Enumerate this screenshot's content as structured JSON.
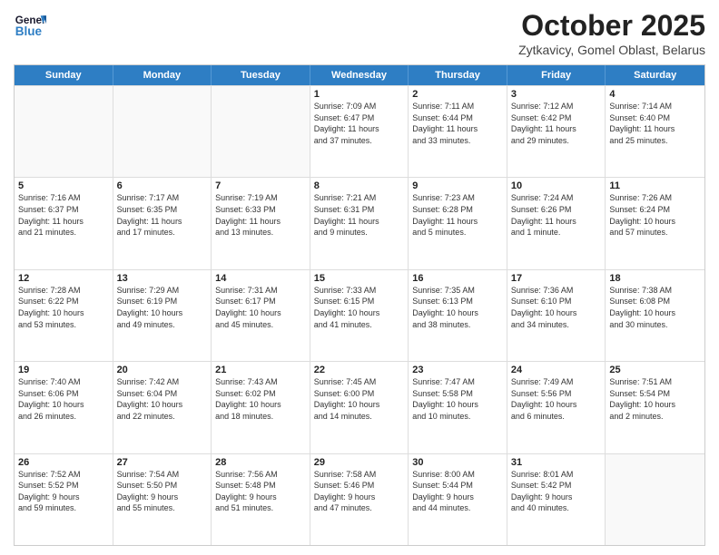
{
  "header": {
    "logo_general": "General",
    "logo_blue": "Blue",
    "title": "October 2025",
    "subtitle": "Zytkavicy, Gomel Oblast, Belarus"
  },
  "weekdays": [
    "Sunday",
    "Monday",
    "Tuesday",
    "Wednesday",
    "Thursday",
    "Friday",
    "Saturday"
  ],
  "rows": [
    {
      "cells": [
        {
          "day": "",
          "lines": [],
          "empty": true
        },
        {
          "day": "",
          "lines": [],
          "empty": true
        },
        {
          "day": "",
          "lines": [],
          "empty": true
        },
        {
          "day": "1",
          "lines": [
            "Sunrise: 7:09 AM",
            "Sunset: 6:47 PM",
            "Daylight: 11 hours",
            "and 37 minutes."
          ],
          "empty": false
        },
        {
          "day": "2",
          "lines": [
            "Sunrise: 7:11 AM",
            "Sunset: 6:44 PM",
            "Daylight: 11 hours",
            "and 33 minutes."
          ],
          "empty": false
        },
        {
          "day": "3",
          "lines": [
            "Sunrise: 7:12 AM",
            "Sunset: 6:42 PM",
            "Daylight: 11 hours",
            "and 29 minutes."
          ],
          "empty": false
        },
        {
          "day": "4",
          "lines": [
            "Sunrise: 7:14 AM",
            "Sunset: 6:40 PM",
            "Daylight: 11 hours",
            "and 25 minutes."
          ],
          "empty": false
        }
      ]
    },
    {
      "cells": [
        {
          "day": "5",
          "lines": [
            "Sunrise: 7:16 AM",
            "Sunset: 6:37 PM",
            "Daylight: 11 hours",
            "and 21 minutes."
          ],
          "empty": false
        },
        {
          "day": "6",
          "lines": [
            "Sunrise: 7:17 AM",
            "Sunset: 6:35 PM",
            "Daylight: 11 hours",
            "and 17 minutes."
          ],
          "empty": false
        },
        {
          "day": "7",
          "lines": [
            "Sunrise: 7:19 AM",
            "Sunset: 6:33 PM",
            "Daylight: 11 hours",
            "and 13 minutes."
          ],
          "empty": false
        },
        {
          "day": "8",
          "lines": [
            "Sunrise: 7:21 AM",
            "Sunset: 6:31 PM",
            "Daylight: 11 hours",
            "and 9 minutes."
          ],
          "empty": false
        },
        {
          "day": "9",
          "lines": [
            "Sunrise: 7:23 AM",
            "Sunset: 6:28 PM",
            "Daylight: 11 hours",
            "and 5 minutes."
          ],
          "empty": false
        },
        {
          "day": "10",
          "lines": [
            "Sunrise: 7:24 AM",
            "Sunset: 6:26 PM",
            "Daylight: 11 hours",
            "and 1 minute."
          ],
          "empty": false
        },
        {
          "day": "11",
          "lines": [
            "Sunrise: 7:26 AM",
            "Sunset: 6:24 PM",
            "Daylight: 10 hours",
            "and 57 minutes."
          ],
          "empty": false
        }
      ]
    },
    {
      "cells": [
        {
          "day": "12",
          "lines": [
            "Sunrise: 7:28 AM",
            "Sunset: 6:22 PM",
            "Daylight: 10 hours",
            "and 53 minutes."
          ],
          "empty": false
        },
        {
          "day": "13",
          "lines": [
            "Sunrise: 7:29 AM",
            "Sunset: 6:19 PM",
            "Daylight: 10 hours",
            "and 49 minutes."
          ],
          "empty": false
        },
        {
          "day": "14",
          "lines": [
            "Sunrise: 7:31 AM",
            "Sunset: 6:17 PM",
            "Daylight: 10 hours",
            "and 45 minutes."
          ],
          "empty": false
        },
        {
          "day": "15",
          "lines": [
            "Sunrise: 7:33 AM",
            "Sunset: 6:15 PM",
            "Daylight: 10 hours",
            "and 41 minutes."
          ],
          "empty": false
        },
        {
          "day": "16",
          "lines": [
            "Sunrise: 7:35 AM",
            "Sunset: 6:13 PM",
            "Daylight: 10 hours",
            "and 38 minutes."
          ],
          "empty": false
        },
        {
          "day": "17",
          "lines": [
            "Sunrise: 7:36 AM",
            "Sunset: 6:10 PM",
            "Daylight: 10 hours",
            "and 34 minutes."
          ],
          "empty": false
        },
        {
          "day": "18",
          "lines": [
            "Sunrise: 7:38 AM",
            "Sunset: 6:08 PM",
            "Daylight: 10 hours",
            "and 30 minutes."
          ],
          "empty": false
        }
      ]
    },
    {
      "cells": [
        {
          "day": "19",
          "lines": [
            "Sunrise: 7:40 AM",
            "Sunset: 6:06 PM",
            "Daylight: 10 hours",
            "and 26 minutes."
          ],
          "empty": false
        },
        {
          "day": "20",
          "lines": [
            "Sunrise: 7:42 AM",
            "Sunset: 6:04 PM",
            "Daylight: 10 hours",
            "and 22 minutes."
          ],
          "empty": false
        },
        {
          "day": "21",
          "lines": [
            "Sunrise: 7:43 AM",
            "Sunset: 6:02 PM",
            "Daylight: 10 hours",
            "and 18 minutes."
          ],
          "empty": false
        },
        {
          "day": "22",
          "lines": [
            "Sunrise: 7:45 AM",
            "Sunset: 6:00 PM",
            "Daylight: 10 hours",
            "and 14 minutes."
          ],
          "empty": false
        },
        {
          "day": "23",
          "lines": [
            "Sunrise: 7:47 AM",
            "Sunset: 5:58 PM",
            "Daylight: 10 hours",
            "and 10 minutes."
          ],
          "empty": false
        },
        {
          "day": "24",
          "lines": [
            "Sunrise: 7:49 AM",
            "Sunset: 5:56 PM",
            "Daylight: 10 hours",
            "and 6 minutes."
          ],
          "empty": false
        },
        {
          "day": "25",
          "lines": [
            "Sunrise: 7:51 AM",
            "Sunset: 5:54 PM",
            "Daylight: 10 hours",
            "and 2 minutes."
          ],
          "empty": false
        }
      ]
    },
    {
      "cells": [
        {
          "day": "26",
          "lines": [
            "Sunrise: 7:52 AM",
            "Sunset: 5:52 PM",
            "Daylight: 9 hours",
            "and 59 minutes."
          ],
          "empty": false
        },
        {
          "day": "27",
          "lines": [
            "Sunrise: 7:54 AM",
            "Sunset: 5:50 PM",
            "Daylight: 9 hours",
            "and 55 minutes."
          ],
          "empty": false
        },
        {
          "day": "28",
          "lines": [
            "Sunrise: 7:56 AM",
            "Sunset: 5:48 PM",
            "Daylight: 9 hours",
            "and 51 minutes."
          ],
          "empty": false
        },
        {
          "day": "29",
          "lines": [
            "Sunrise: 7:58 AM",
            "Sunset: 5:46 PM",
            "Daylight: 9 hours",
            "and 47 minutes."
          ],
          "empty": false
        },
        {
          "day": "30",
          "lines": [
            "Sunrise: 8:00 AM",
            "Sunset: 5:44 PM",
            "Daylight: 9 hours",
            "and 44 minutes."
          ],
          "empty": false
        },
        {
          "day": "31",
          "lines": [
            "Sunrise: 8:01 AM",
            "Sunset: 5:42 PM",
            "Daylight: 9 hours",
            "and 40 minutes."
          ],
          "empty": false
        },
        {
          "day": "",
          "lines": [],
          "empty": true
        }
      ]
    }
  ]
}
